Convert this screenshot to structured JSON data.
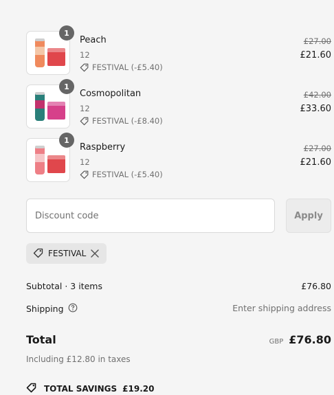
{
  "items": [
    {
      "name": "Peach",
      "quantity": "1",
      "variant": "12",
      "discount": "FESTIVAL (-£5.40)",
      "original_price": "£27.00",
      "price": "£21.60",
      "can_color": "#f08a5d",
      "can_band": "#f4c7a8",
      "case_color": "#e0474c"
    },
    {
      "name": "Cosmopolitan",
      "quantity": "1",
      "variant": "12",
      "discount": "FESTIVAL (-£8.40)",
      "original_price": "£42.00",
      "price": "£33.60",
      "can_color": "#2a7f7a",
      "can_band": "#c2326d",
      "case_color": "#d6408a"
    },
    {
      "name": "Raspberry",
      "quantity": "1",
      "variant": "12",
      "discount": "FESTIVAL (-£5.40)",
      "original_price": "£27.00",
      "price": "£21.60",
      "can_color": "#ee7f86",
      "can_band": "#f6c6c8",
      "case_color": "#e0474c"
    }
  ],
  "discount": {
    "placeholder": "Discount code",
    "apply_label": "Apply",
    "applied_code": "FESTIVAL"
  },
  "summary": {
    "subtotal_label": "Subtotal · 3 items",
    "subtotal_value": "£76.80",
    "shipping_label": "Shipping",
    "shipping_value": "Enter shipping address",
    "total_label": "Total",
    "currency": "GBP",
    "total_value": "£76.80",
    "taxes_note": "Including £12.80 in taxes",
    "savings_label": "TOTAL SAVINGS",
    "savings_value": "£19.20"
  },
  "icons": {
    "tag": "tag-icon",
    "close": "close-icon",
    "help": "help-circle-icon",
    "savings": "savings-tag-icon"
  }
}
